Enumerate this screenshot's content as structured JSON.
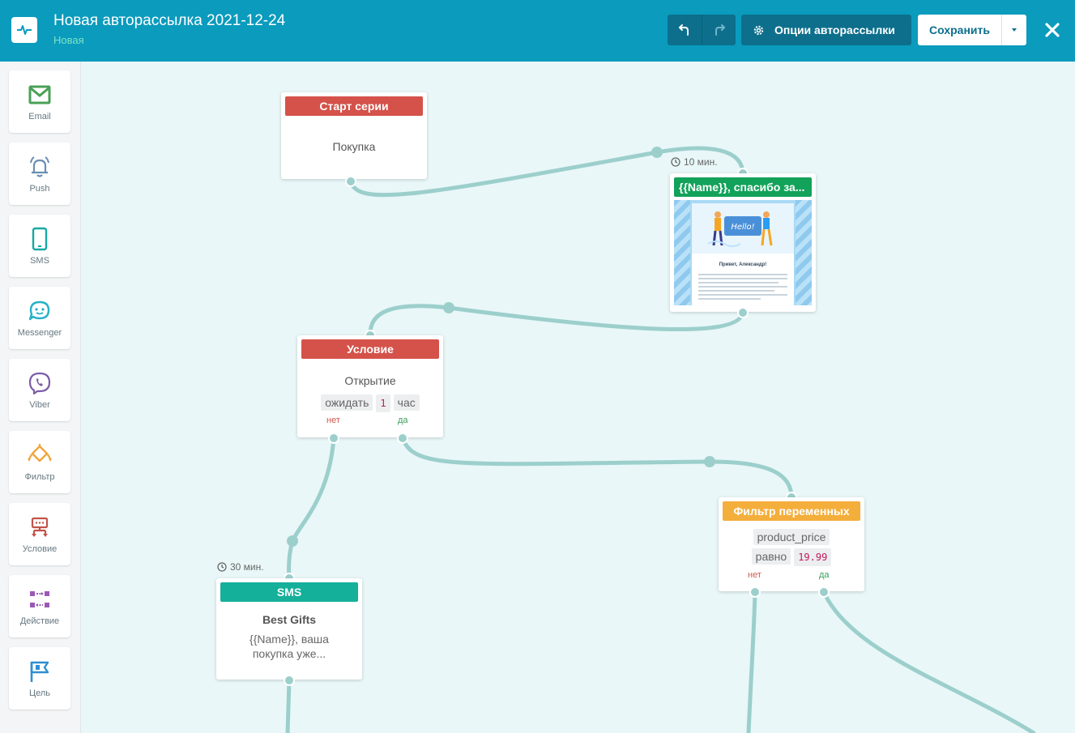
{
  "header": {
    "title": "Новая авторассылка 2021-12-24",
    "status": "Новая",
    "options_label": "Опции авторассылки",
    "save_label": "Сохранить"
  },
  "sidebar": {
    "items": [
      {
        "label": "Email",
        "icon": "envelope-icon"
      },
      {
        "label": "Push",
        "icon": "bell-icon"
      },
      {
        "label": "SMS",
        "icon": "phone-icon"
      },
      {
        "label": "Messenger",
        "icon": "chat-icon"
      },
      {
        "label": "Viber",
        "icon": "viber-icon"
      },
      {
        "label": "Фильтр",
        "icon": "filter-icon"
      },
      {
        "label": "Условие",
        "icon": "condition-icon"
      },
      {
        "label": "Действие",
        "icon": "action-icon"
      },
      {
        "label": "Цель",
        "icon": "flag-icon"
      }
    ]
  },
  "nodes": {
    "start": {
      "header": "Старт серии",
      "title": "Покупка"
    },
    "email": {
      "timer": "10 мин.",
      "header": "{{Name}}, спасибо за...",
      "preview_title": "Привет, Александр!"
    },
    "condition": {
      "header": "Условие",
      "title": "Открытие",
      "chip_wait": "ожидать",
      "chip_num": "1",
      "chip_unit": "час",
      "no": "нет",
      "yes": "да"
    },
    "sms": {
      "timer": "30 мин.",
      "header": "SMS",
      "title": "Best Gifts",
      "text": "{{Name}}, ваша покупка уже..."
    },
    "filter": {
      "header": "Фильтр переменных",
      "chip_var": "product_price",
      "chip_op": "равно",
      "chip_val": "19.99",
      "no": "нет",
      "yes": "да"
    }
  },
  "colors": {
    "header_bg": "#0a9bbd",
    "start": "#d4524a",
    "email": "#12a25a",
    "condition": "#d4524a",
    "sms": "#14b09a",
    "filter": "#f4ae3b",
    "link": "#9ccfcc"
  }
}
